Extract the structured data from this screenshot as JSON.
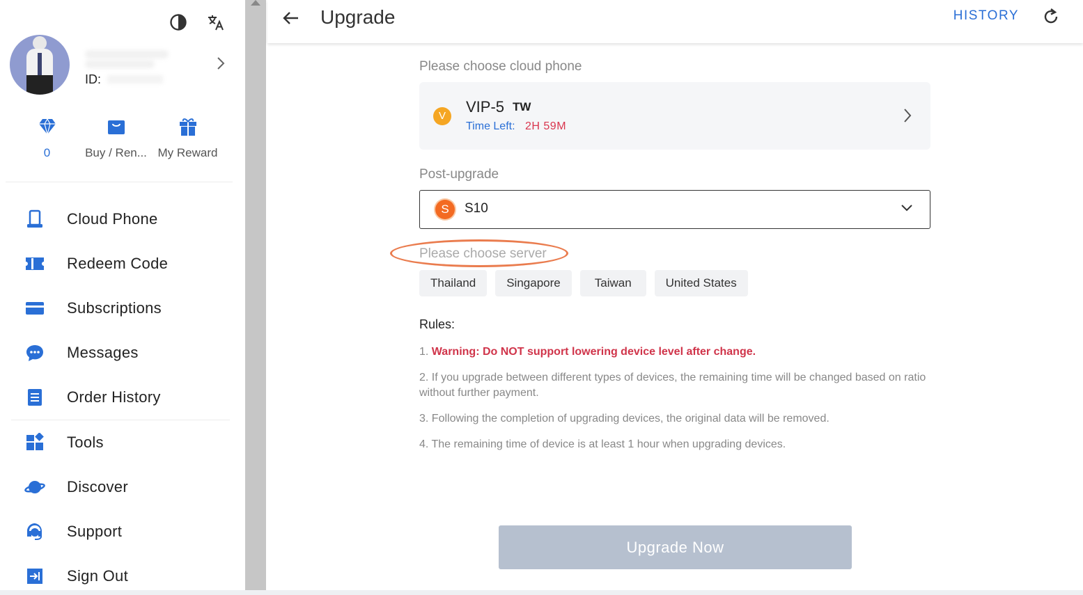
{
  "sidebar": {
    "id_label": "ID:",
    "stats": [
      {
        "icon": "diamond-icon",
        "label": "0"
      },
      {
        "icon": "shopping-bag-icon",
        "label": "Buy / Ren..."
      },
      {
        "icon": "gift-icon",
        "label": "My Reward"
      }
    ],
    "menu": [
      {
        "icon": "phone-icon",
        "label": "Cloud Phone"
      },
      {
        "icon": "ticket-icon",
        "label": "Redeem Code"
      },
      {
        "icon": "card-icon",
        "label": "Subscriptions"
      },
      {
        "icon": "chat-icon",
        "label": "Messages"
      },
      {
        "icon": "document-icon",
        "label": "Order History"
      },
      {
        "icon": "grid-icon",
        "label": "Tools"
      },
      {
        "icon": "planet-icon",
        "label": "Discover"
      },
      {
        "icon": "headset-icon",
        "label": "Support"
      },
      {
        "icon": "logout-icon",
        "label": "Sign Out"
      }
    ]
  },
  "header": {
    "title": "Upgrade",
    "history_label": "HISTORY"
  },
  "main": {
    "choose_phone_label": "Please choose cloud phone",
    "phone": {
      "badge": "V",
      "name": "VIP-5",
      "region": "TW",
      "time_left_label": "Time Left:",
      "time_left_value": "2H  59M"
    },
    "post_upgrade_label": "Post-upgrade",
    "post_upgrade": {
      "badge": "S",
      "value": "S10"
    },
    "server_label": "Please choose server",
    "servers": [
      "Thailand",
      "Singapore",
      "Taiwan",
      "United States"
    ],
    "rules_title": "Rules:",
    "rules": [
      {
        "prefix": "1. ",
        "text": "Warning: Do NOT support lowering device level after change."
      },
      {
        "prefix": "",
        "text": "2. If you upgrade between different types of devices, the remaining time will be changed based on ratio without further payment."
      },
      {
        "prefix": "",
        "text": "3. Following the completion of upgrading devices, the original data will be removed."
      },
      {
        "prefix": "",
        "text": "4. The remaining time of device is at least 1 hour when upgrading devices."
      }
    ],
    "upgrade_button": "Upgrade Now"
  },
  "colors": {
    "accent": "#2a6fd6",
    "warning": "#d0344a",
    "time_left": "#d9364e",
    "highlight_oval": "#ea7c4e",
    "disabled_button": "#b6c0cf"
  }
}
